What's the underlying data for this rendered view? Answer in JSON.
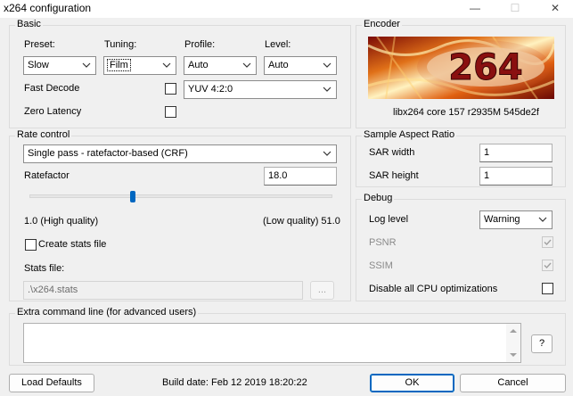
{
  "window": {
    "title": "x264 configuration",
    "minimize_glyph": "—",
    "maximize_glyph": "☐",
    "close_glyph": "✕"
  },
  "basic": {
    "legend": "Basic",
    "preset_label": "Preset:",
    "preset_value": "Slow",
    "tuning_label": "Tuning:",
    "tuning_value": "Film",
    "profile_label": "Profile:",
    "profile_value": "Auto",
    "level_label": "Level:",
    "level_value": "Auto",
    "fast_decode_label": "Fast Decode",
    "fast_decode_checked": false,
    "colorspace_value": "YUV 4:2:0",
    "zero_latency_label": "Zero Latency",
    "zero_latency_checked": false
  },
  "encoder": {
    "legend": "Encoder",
    "logo_text": "264",
    "version": "libx264 core 157 r2935M 545de2f"
  },
  "rate_control": {
    "legend": "Rate control",
    "mode_value": "Single pass - ratefactor-based (CRF)",
    "ratefactor_label": "Ratefactor",
    "ratefactor_value": "18.0",
    "slider_fraction": 0.34,
    "min_label": "1.0 (High quality)",
    "max_label": "(Low quality) 51.0",
    "create_stats_label": "Create stats file",
    "create_stats_checked": false,
    "stats_file_label": "Stats file:",
    "stats_file_value": ".\\x264.stats",
    "browse_label": "..."
  },
  "sar": {
    "legend": "Sample Aspect Ratio",
    "width_label": "SAR width",
    "width_value": "1",
    "height_label": "SAR height",
    "height_value": "1"
  },
  "debug": {
    "legend": "Debug",
    "log_level_label": "Log level",
    "log_level_value": "Warning",
    "psnr_label": "PSNR",
    "psnr_checked": true,
    "ssim_label": "SSIM",
    "ssim_checked": true,
    "disable_cpu_label": "Disable all CPU optimizations",
    "disable_cpu_checked": false
  },
  "extra": {
    "legend": "Extra command line (for advanced users)",
    "value": "",
    "help_label": "?"
  },
  "footer": {
    "load_defaults_label": "Load Defaults",
    "build_date": "Build date: Feb 12 2019 18:20:22",
    "ok_label": "OK",
    "cancel_label": "Cancel"
  },
  "colors": {
    "accent": "#0067c0",
    "window_bg": "#f0f0f0",
    "logo_red": "#a01010",
    "logo_orange": "#f08020"
  },
  "icons": {
    "dropdown": "chevron-down-icon",
    "checkmark": "check-icon"
  }
}
